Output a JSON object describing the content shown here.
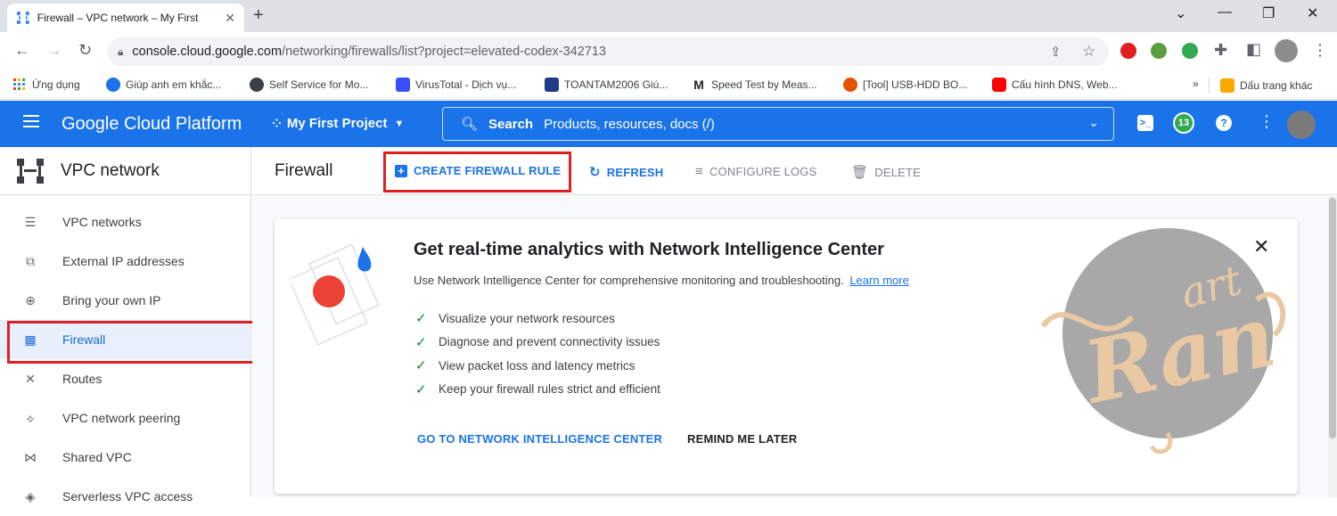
{
  "browser": {
    "tab_title": "Firewall – VPC network – My First",
    "tab_close": "✕",
    "new_tab": "+",
    "url_host": "console.cloud.google.com",
    "url_path": "/networking/firewalls/list?project=elevated-codex-342713",
    "bookmarks": [
      {
        "label": "Ứng dụng",
        "color": "#4285f4"
      },
      {
        "label": "Giúp anh em khắc...",
        "color": "#1a73e8"
      },
      {
        "label": "Self Service for Mo...",
        "color": "#3c4043"
      },
      {
        "label": "VirusTotal - Dịch vụ...",
        "color": "#394eff"
      },
      {
        "label": "TOANTAM2006 Giú...",
        "color": "#1f3c88"
      },
      {
        "label": "Speed Test by Meas...",
        "color": "#202124"
      },
      {
        "label": "[Tool] USB-HDD BO...",
        "color": "#e65100"
      },
      {
        "label": "Cấu hình DNS, Web...",
        "color": "#ff0000"
      }
    ],
    "bookmarks_more": "»",
    "other_bookmarks": "Dấu trang khác"
  },
  "gcp": {
    "logo": "Google Cloud Platform",
    "project": "My First Project",
    "search_label": "Search",
    "search_hint": "Products, resources, docs (/)",
    "notif_count": "13"
  },
  "sidebar": {
    "title": "VPC network",
    "items": [
      {
        "label": "VPC networks",
        "icon": "vpc-networks-icon"
      },
      {
        "label": "External IP addresses",
        "icon": "external-ip-icon"
      },
      {
        "label": "Bring your own IP",
        "icon": "globe-icon"
      },
      {
        "label": "Firewall",
        "icon": "firewall-icon",
        "active": true
      },
      {
        "label": "Routes",
        "icon": "routes-icon"
      },
      {
        "label": "VPC network peering",
        "icon": "peering-icon"
      },
      {
        "label": "Shared VPC",
        "icon": "shared-vpc-icon"
      },
      {
        "label": "Serverless VPC access",
        "icon": "serverless-icon"
      }
    ]
  },
  "actionbar": {
    "title": "Firewall",
    "create": "CREATE FIREWALL RULE",
    "refresh": "REFRESH",
    "configure_logs": "CONFIGURE LOGS",
    "delete": "DELETE"
  },
  "promo": {
    "title": "Get real-time analytics with Network Intelligence Center",
    "subtitle": "Use Network Intelligence Center for comprehensive monitoring and troubleshooting.",
    "learn_more": "Learn more",
    "checks": [
      "Visualize your network resources",
      "Diagnose and prevent connectivity issues",
      "View packet loss and latency metrics",
      "Keep your firewall rules strict and efficient"
    ],
    "primary_button": "GO TO NETWORK INTELLIGENCE CENTER",
    "secondary_button": "REMIND ME LATER",
    "close": "✕"
  },
  "colors": {
    "accent": "#1a73e8",
    "highlight_frame": "#e0201f",
    "check": "#188038"
  }
}
